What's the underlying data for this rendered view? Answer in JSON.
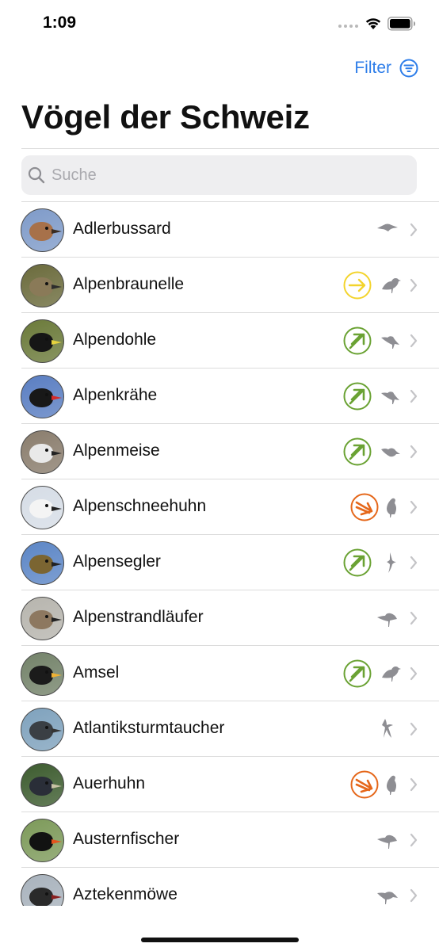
{
  "status_bar": {
    "time": "1:09"
  },
  "header": {
    "filter_label": "Filter",
    "title": "Vögel der Schweiz"
  },
  "search": {
    "placeholder": "Suche",
    "value": ""
  },
  "colors": {
    "accent": "#2d7de9",
    "yellow": "#f3d42c",
    "green": "#6aa233",
    "orange": "#e5671a",
    "silhouette": "#8e8e93",
    "chevron": "#c4c4c7"
  },
  "birds": [
    {
      "name": "Adlerbussard",
      "status": null,
      "silhouette": "raptor-silhouette-icon",
      "photo": {
        "bg": "#7f9bc9",
        "head": "#a7714a",
        "beak": "#3a2c22"
      }
    },
    {
      "name": "Alpenbraunelle",
      "status": "yellow",
      "silhouette": "songbird-silhouette-icon",
      "photo": {
        "bg": "#6b6b3c",
        "head": "#8a7a58",
        "beak": "#2c2c2c"
      }
    },
    {
      "name": "Alpendohle",
      "status": "green",
      "silhouette": "crow-silhouette-icon",
      "photo": {
        "bg": "#6b7a3a",
        "head": "#161616",
        "beak": "#e5d23e"
      }
    },
    {
      "name": "Alpenkrähe",
      "status": "green",
      "silhouette": "crow-silhouette-icon",
      "photo": {
        "bg": "#5a7ec2",
        "head": "#181818",
        "beak": "#d52b2b"
      }
    },
    {
      "name": "Alpenmeise",
      "status": "green",
      "silhouette": "small-bird-silhouette-icon",
      "photo": {
        "bg": "#8a7d6d",
        "head": "#e9e9e9",
        "beak": "#222"
      }
    },
    {
      "name": "Alpenschneehuhn",
      "status": "orange",
      "silhouette": "grouse-silhouette-icon",
      "photo": {
        "bg": "#d6dde6",
        "head": "#f4f4f4",
        "beak": "#222"
      }
    },
    {
      "name": "Alpensegler",
      "status": "green",
      "silhouette": "swift-silhouette-icon",
      "photo": {
        "bg": "#5c86c6",
        "head": "#7b6532",
        "beak": "#222"
      }
    },
    {
      "name": "Alpenstrandläufer",
      "status": null,
      "silhouette": "wader-silhouette-icon",
      "photo": {
        "bg": "#b7b5ae",
        "head": "#8d7860",
        "beak": "#222"
      }
    },
    {
      "name": "Amsel",
      "status": "green",
      "silhouette": "songbird-silhouette-icon",
      "photo": {
        "bg": "#74836a",
        "head": "#1b1b1b",
        "beak": "#f0b233"
      }
    },
    {
      "name": "Atlantiksturmtaucher",
      "status": null,
      "silhouette": "seabird-silhouette-icon",
      "photo": {
        "bg": "#7fa2bd",
        "head": "#3a3f44",
        "beak": "#333"
      }
    },
    {
      "name": "Auerhuhn",
      "status": "orange",
      "silhouette": "grouse-silhouette-icon",
      "photo": {
        "bg": "#3d5c2f",
        "head": "#2a2e38",
        "beak": "#c9c2a5"
      }
    },
    {
      "name": "Austernfischer",
      "status": null,
      "silhouette": "wader-silhouette-icon",
      "photo": {
        "bg": "#7d9a5a",
        "head": "#121212",
        "beak": "#e3541e"
      }
    },
    {
      "name": "Aztekenmöwe",
      "status": null,
      "silhouette": "gull-silhouette-icon",
      "photo": {
        "bg": "#a9b3bd",
        "head": "#2a2a2a",
        "beak": "#8a1f1f"
      }
    }
  ]
}
